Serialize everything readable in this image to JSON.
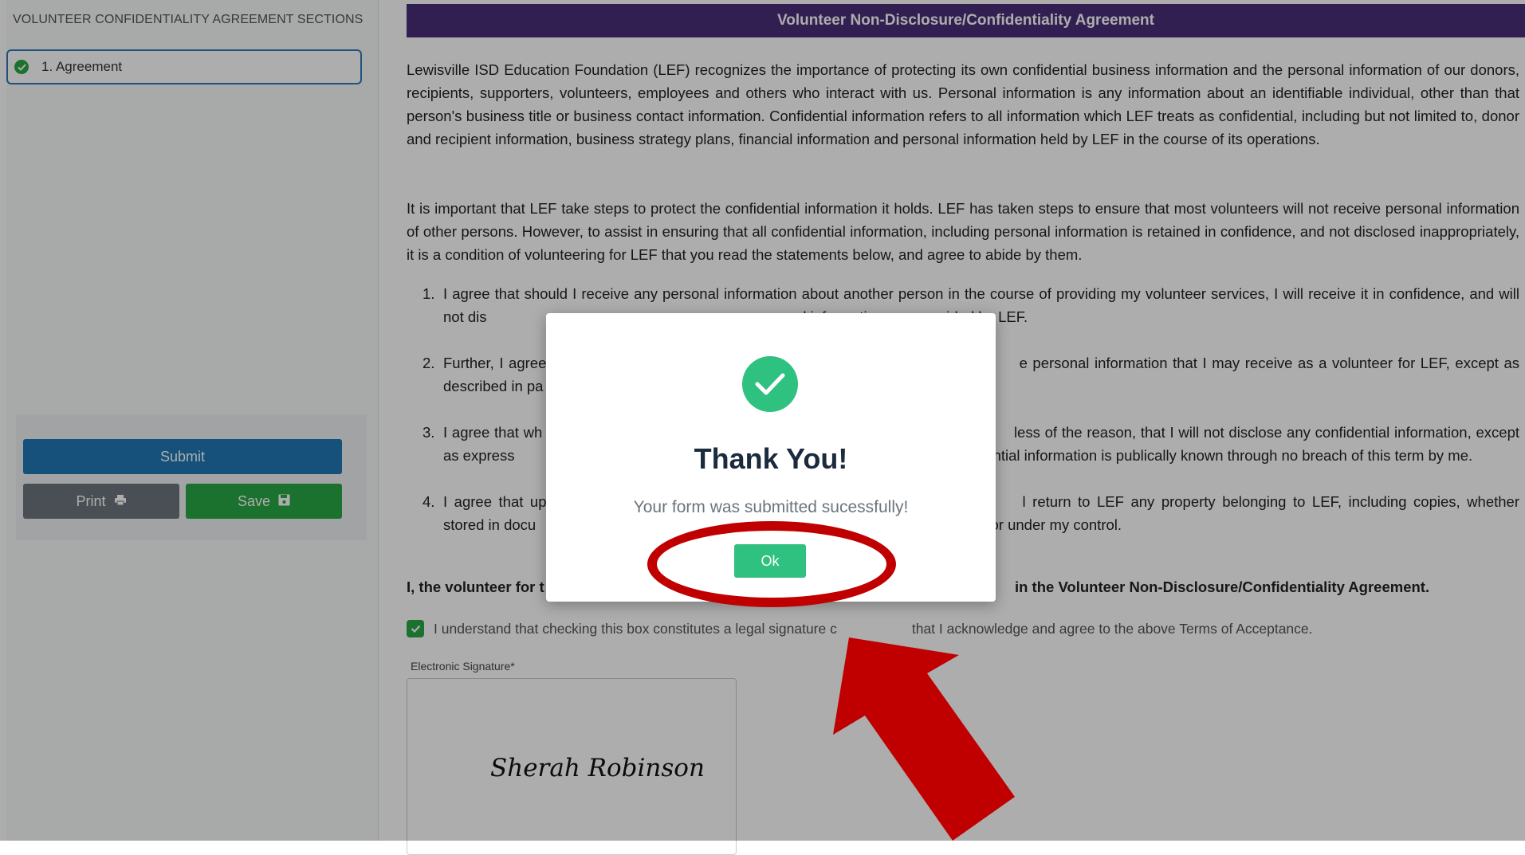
{
  "sidebar": {
    "title": "VOLUNTEER CONFIDENTIALITY AGREEMENT SECTIONS",
    "items": [
      {
        "label": "1. Agreement",
        "status": "complete"
      }
    ],
    "buttons": {
      "submit": "Submit",
      "print": "Print",
      "save": "Save"
    }
  },
  "document": {
    "header": "Volunteer Non-Disclosure/Confidentiality Agreement",
    "p1": "Lewisville ISD Education Foundation (LEF) recognizes the importance of protecting its own confidential business information and the personal information of our donors, recipients, supporters, volunteers, employees and others who interact with us. Personal information is any information about an identifiable individual, other than that person's business title or business contact information. Confidential information refers to all information which LEF treats as confidential, including but not limited to, donor and recipient information, business strategy plans, financial information and personal information held by LEF in the course of its operations.",
    "p2": "It is important that LEF take steps to protect the confidential information it holds. LEF has taken steps to ensure that most volunteers will not receive personal information of other persons. However, to assist in ensuring that all confidential information, including personal information is retained in confidence, and not disclosed inappropriately, it is a condition of volunteering for LEF that you read the statements below, and agree to abide by them.",
    "list": [
      {
        "num": "1.",
        "text": "I agree that should I receive any personal information about another person in the course of providing my volunteer services, I will receive it in confidence, and will not dis",
        "text_after": "ersonal information was provided by LEF."
      },
      {
        "num": "2.",
        "text": "Further, I agree",
        "text_after": "e personal information that I may receive as a volunteer for LEF, except as described in pa"
      },
      {
        "num": "3.",
        "text": "I agree that wh",
        "text_after": "less of the reason, that I will not disclose any confidential information, except as express",
        "text_after2": "fidential information is publically known through no breach of this term by me."
      },
      {
        "num": "4.",
        "text": "I agree that up",
        "text_after": "l return to LEF any property belonging to LEF, including copies, whether stored in docu",
        "text_after2": "or under my control."
      }
    ],
    "bold_line_start": "I, the volunteer for t",
    "bold_line_end": "in the Volunteer Non-Disclosure/Confidentiality Agreement.",
    "ack_start": "I understand that checking this box constitutes a legal signature c",
    "ack_end": "that I acknowledge and agree to the above Terms of Acceptance.",
    "sig_label": "Electronic Signature*",
    "sig_value": "Sherah Robinson"
  },
  "modal": {
    "title": "Thank You!",
    "message": "Your form was submitted sucessfully!",
    "ok": "Ok",
    "success_color": "#2fc17f"
  },
  "annotation_color": "#c00000"
}
